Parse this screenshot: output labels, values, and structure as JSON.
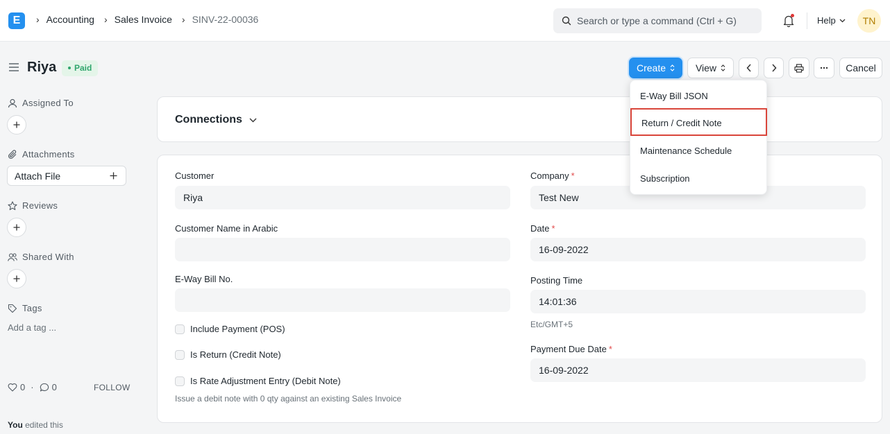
{
  "navbar": {
    "logo_letter": "E",
    "breadcrumbs": [
      "Accounting",
      "Sales Invoice",
      "SINV-22-00036"
    ],
    "search_placeholder": "Search or type a command (Ctrl + G)",
    "help_label": "Help",
    "avatar_initials": "TN"
  },
  "page": {
    "title": "Riya",
    "status": "Paid",
    "buttons": {
      "create": "Create",
      "view": "View",
      "cancel": "Cancel"
    }
  },
  "create_menu": {
    "items": [
      "E-Way Bill JSON",
      "Return / Credit Note",
      "Maintenance Schedule",
      "Subscription"
    ],
    "highlighted": "Return / Credit Note"
  },
  "sidebar": {
    "assigned_to": "Assigned To",
    "attachments": "Attachments",
    "attach_file": "Attach File",
    "reviews": "Reviews",
    "shared_with": "Shared With",
    "tags": "Tags",
    "add_tag": "Add a tag ...",
    "likes": "0",
    "comments": "0",
    "separator": "·",
    "follow": "FOLLOW",
    "edited_user": "You",
    "edited_text": " edited this"
  },
  "connections": {
    "title": "Connections"
  },
  "form": {
    "customer_label": "Customer",
    "customer_value": "Riya",
    "customer_name_arabic_label": "Customer Name in Arabic",
    "customer_name_arabic_value": "",
    "eway_bill_label": "E-Way Bill No.",
    "eway_bill_value": "",
    "include_payment_label": "Include Payment (POS)",
    "is_return_label": "Is Return (Credit Note)",
    "is_rate_adjustment_label": "Is Rate Adjustment Entry (Debit Note)",
    "rate_adjustment_desc": "Issue a debit note with 0 qty against an existing Sales Invoice",
    "company_label": "Company",
    "company_value": "Test New",
    "date_label": "Date",
    "date_value": "16-09-2022",
    "posting_time_label": "Posting Time",
    "posting_time_value": "14:01:36",
    "timezone": "Etc/GMT+5",
    "payment_due_label": "Payment Due Date",
    "payment_due_value": "16-09-2022",
    "required_mark": "*"
  }
}
